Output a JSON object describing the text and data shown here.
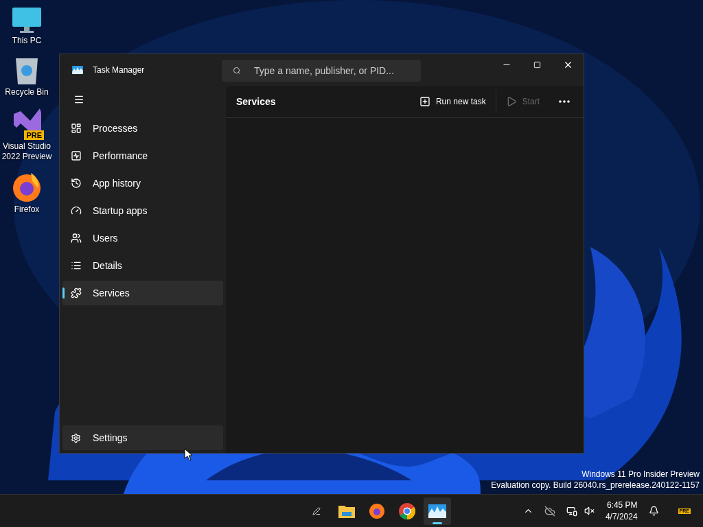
{
  "desktop_icons": [
    {
      "kind": "monitor",
      "label": "This PC"
    },
    {
      "kind": "bin",
      "label": "Recycle Bin"
    },
    {
      "kind": "vs",
      "label": "Visual Studio 2022 Preview",
      "badge": "PRE"
    },
    {
      "kind": "firefox",
      "label": "Firefox"
    }
  ],
  "window": {
    "title": "Task Manager",
    "search": {
      "placeholder": "Type a name, publisher, or PID..."
    }
  },
  "sidebar": {
    "items": [
      {
        "kind": "processes",
        "label": "Processes",
        "selected": false
      },
      {
        "kind": "performance",
        "label": "Performance",
        "selected": false
      },
      {
        "kind": "history",
        "label": "App history",
        "selected": false
      },
      {
        "kind": "startup",
        "label": "Startup apps",
        "selected": false
      },
      {
        "kind": "users",
        "label": "Users",
        "selected": false
      },
      {
        "kind": "details",
        "label": "Details",
        "selected": false
      },
      {
        "kind": "services",
        "label": "Services",
        "selected": true
      }
    ],
    "settings": {
      "label": "Settings"
    }
  },
  "page": {
    "title": "Services",
    "toolbar": [
      {
        "kind": "run",
        "label": "Run new task",
        "disabled": false
      },
      {
        "kind": "start",
        "label": "Start",
        "disabled": true
      }
    ]
  },
  "watermark": {
    "line1": "Windows 11 Pro Insider Preview",
    "line2": "Evaluation copy. Build 26040.rs_prerelease.240122-1157"
  },
  "taskbar": {
    "apps": [
      {
        "kind": "pen",
        "active": false
      },
      {
        "kind": "explorer",
        "active": false
      },
      {
        "kind": "firefox",
        "active": false
      },
      {
        "kind": "chrome",
        "active": false
      },
      {
        "kind": "taskmgr",
        "active": true
      }
    ],
    "time": "6:45 PM",
    "date": "4/7/2024",
    "badge": "PRE"
  }
}
